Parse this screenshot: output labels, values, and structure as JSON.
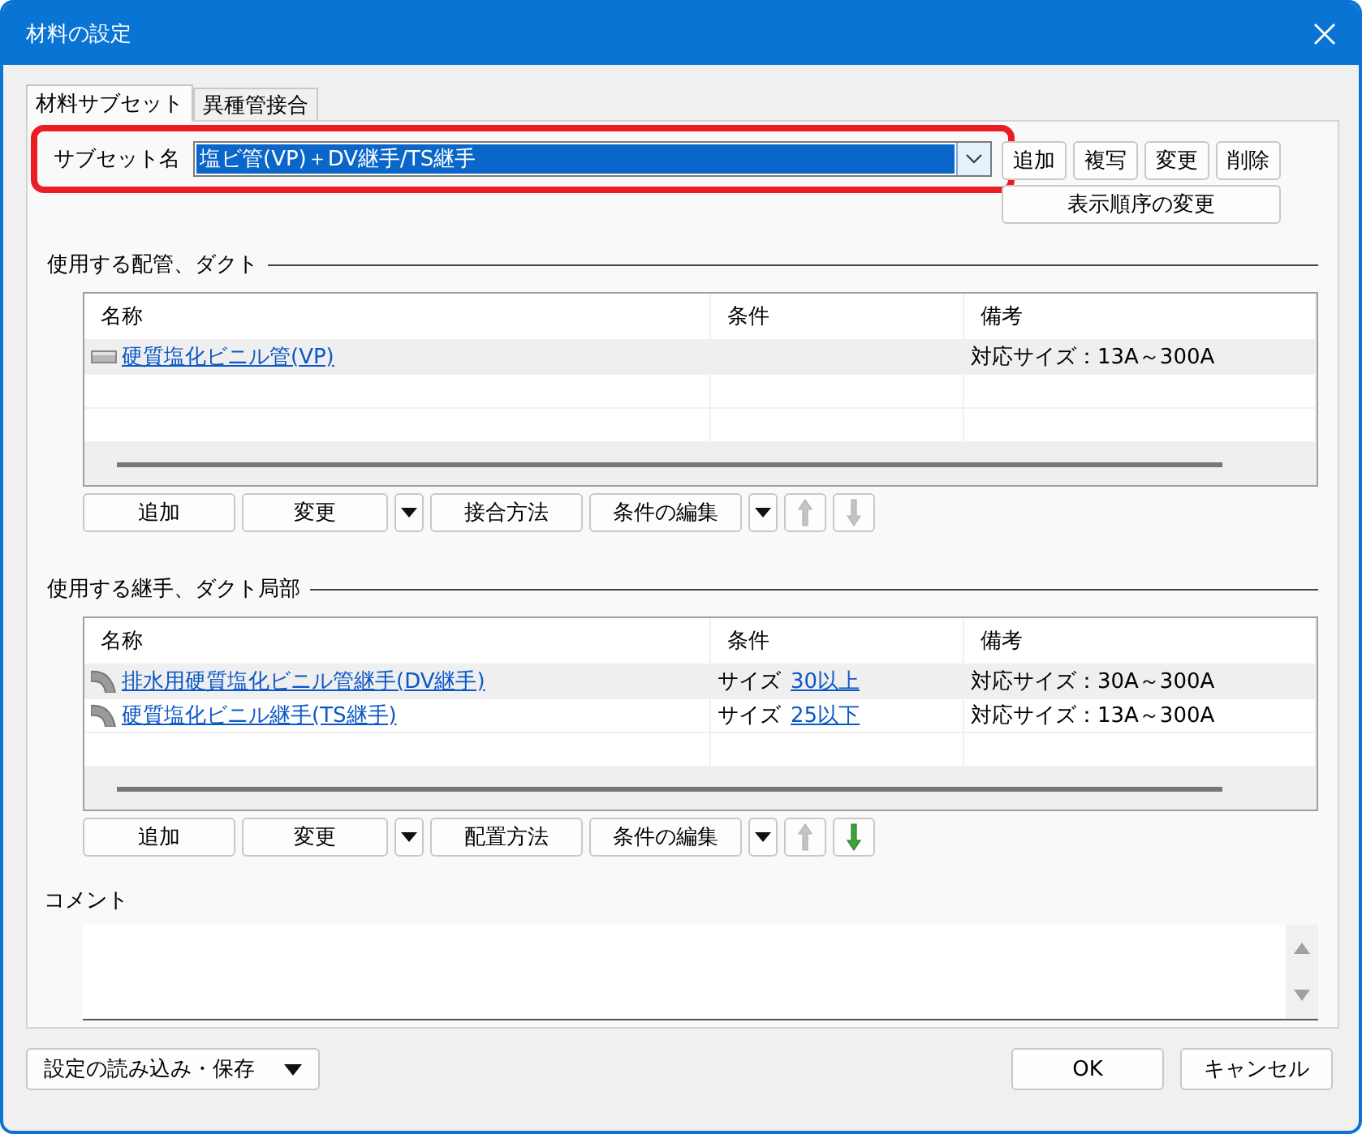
{
  "window": {
    "title": "材料の設定"
  },
  "tabs": [
    {
      "label": "材料サブセット",
      "selected": true
    },
    {
      "label": "異種管接合",
      "selected": false
    }
  ],
  "subset": {
    "label": "サブセット名",
    "value": "塩ビ管(VP)＋DV継手/TS継手",
    "highlighted": true,
    "buttons": [
      "追加",
      "複写",
      "変更",
      "削除"
    ],
    "reorder_button": "表示順序の変更"
  },
  "sections": [
    {
      "title": "使用する配管、ダクト",
      "columns": [
        "名称",
        "条件",
        "備考"
      ],
      "rows": [
        {
          "kind": "pipe",
          "name": "硬質塩化ビニル管(VP)",
          "selected": true,
          "note": "対応サイズ：13A～300A"
        }
      ],
      "buttons": [
        {
          "label": "追加",
          "dropdown": false
        },
        {
          "label": "変更",
          "dropdown": true
        },
        {
          "label": "接合方法",
          "dropdown": false
        },
        {
          "label": "条件の編集",
          "dropdown": true
        }
      ],
      "move_up_enabled": false,
      "move_down_enabled": false
    },
    {
      "title": "使用する継手、ダクト局部",
      "columns": [
        "名称",
        "条件",
        "備考"
      ],
      "rows": [
        {
          "kind": "elbow",
          "name": "排水用硬質塩化ビニル管継手(DV継手)",
          "selected": true,
          "condition": "サイズ",
          "condition_link": "30以上",
          "note": "対応サイズ：30A～300A"
        },
        {
          "kind": "elbow",
          "name": "硬質塩化ビニル継手(TS継手)",
          "selected": false,
          "condition": "サイズ",
          "condition_link": "25以下",
          "note": "対応サイズ：13A～300A"
        }
      ],
      "buttons": [
        {
          "label": "追加",
          "dropdown": false
        },
        {
          "label": "変更",
          "dropdown": true
        },
        {
          "label": "配置方法",
          "dropdown": false
        },
        {
          "label": "条件の編集",
          "dropdown": true
        }
      ],
      "move_up_enabled": false,
      "move_down_enabled": true
    }
  ],
  "comment": {
    "label": "コメント"
  },
  "footer": {
    "menu_button": "設定の読み込み・保存",
    "ok": "OK",
    "cancel": "キャンセル"
  }
}
